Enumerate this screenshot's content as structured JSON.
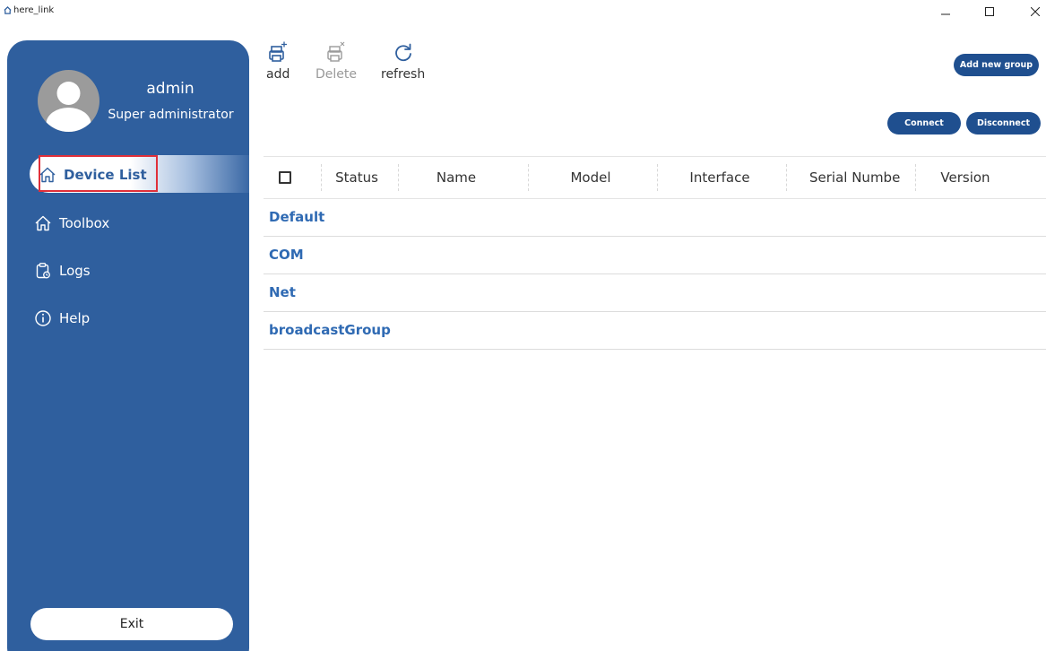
{
  "window": {
    "title": "here_link",
    "minimize": "–",
    "maximize": "☐",
    "close": "✕"
  },
  "user": {
    "name": "admin",
    "role": "Super administrator"
  },
  "nav": {
    "active": "Device List",
    "items": [
      "Toolbox",
      "Logs",
      "Help"
    ]
  },
  "exit_label": "Exit",
  "toolbar": {
    "add": "add",
    "delete": "Delete",
    "refresh": "refresh"
  },
  "buttons": {
    "add_group": "Add new group",
    "connect": "Connect",
    "disconnect": "Disconnect"
  },
  "table": {
    "columns": [
      "Status",
      "Name",
      "Model",
      "Interface",
      "Serial Numbe",
      "Version"
    ]
  },
  "groups": [
    "Default",
    "COM",
    "Net",
    "broadcastGroup"
  ],
  "colors": {
    "sidebar": "#2f5f9e",
    "accent_button": "#1f4f8f",
    "group_text": "#2f6ab3",
    "highlight": "#e0303a"
  }
}
